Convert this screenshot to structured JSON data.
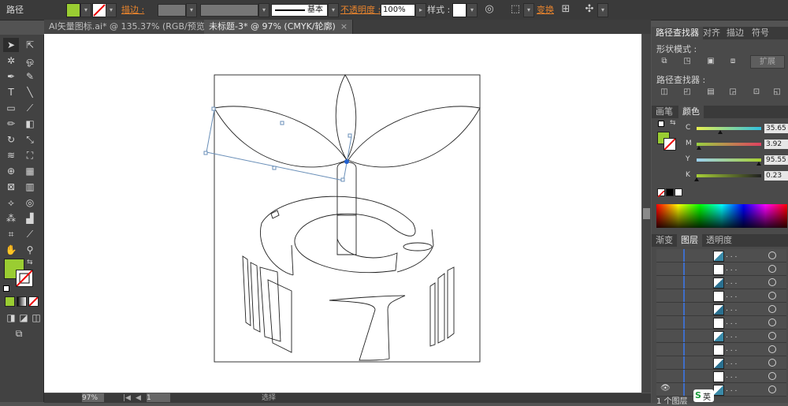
{
  "control_bar": {
    "path_label": "路径",
    "fill_color": "#9acd32",
    "stroke_label": "描边 :",
    "stroke_style_label": "基本",
    "opacity_label": "不透明度 :",
    "opacity_value": "100%",
    "style_label": "样式 :",
    "transform_label": "变换"
  },
  "doc_tabs": [
    {
      "label": "AI矢量图标.ai* @ 135.37% (RGB/预览)",
      "close": "×"
    },
    {
      "label": "未标题-3* @ 97% (CMYK/轮廓)",
      "close": "×"
    }
  ],
  "status": {
    "zoom": "97%",
    "page": "1",
    "mode": "选择"
  },
  "pathfinder": {
    "tabs": [
      "路径查找器",
      "对齐",
      "描边",
      "符号"
    ],
    "shape_modes_label": "形状模式 :",
    "expand_label": "扩展",
    "pathfinders_label": "路径查找器 :"
  },
  "color_panel": {
    "tabs": [
      "画笔",
      "颜色"
    ],
    "fill_color": "#9acd32",
    "channels": [
      {
        "name": "C",
        "value": "35.65",
        "fraction": 0.36,
        "gradient": "linear-gradient(to right,#e8f050,#30c0e0)"
      },
      {
        "name": "M",
        "value": "3.92",
        "fraction": 0.04,
        "gradient": "linear-gradient(to right,#9ad040,#e04060)"
      },
      {
        "name": "Y",
        "value": "95.55",
        "fraction": 0.96,
        "gradient": "linear-gradient(to right,#9ad0f0,#a8d030)"
      },
      {
        "name": "K",
        "value": "0.23",
        "fraction": 0.0,
        "gradient": "linear-gradient(to right,#a8d038,#202020)"
      }
    ]
  },
  "layers_panel": {
    "tabs": [
      "渐变",
      "图层",
      "透明度"
    ],
    "row_label": ". . .",
    "footer": "1 个图层"
  },
  "watermark": {
    "ime_text": "英"
  }
}
